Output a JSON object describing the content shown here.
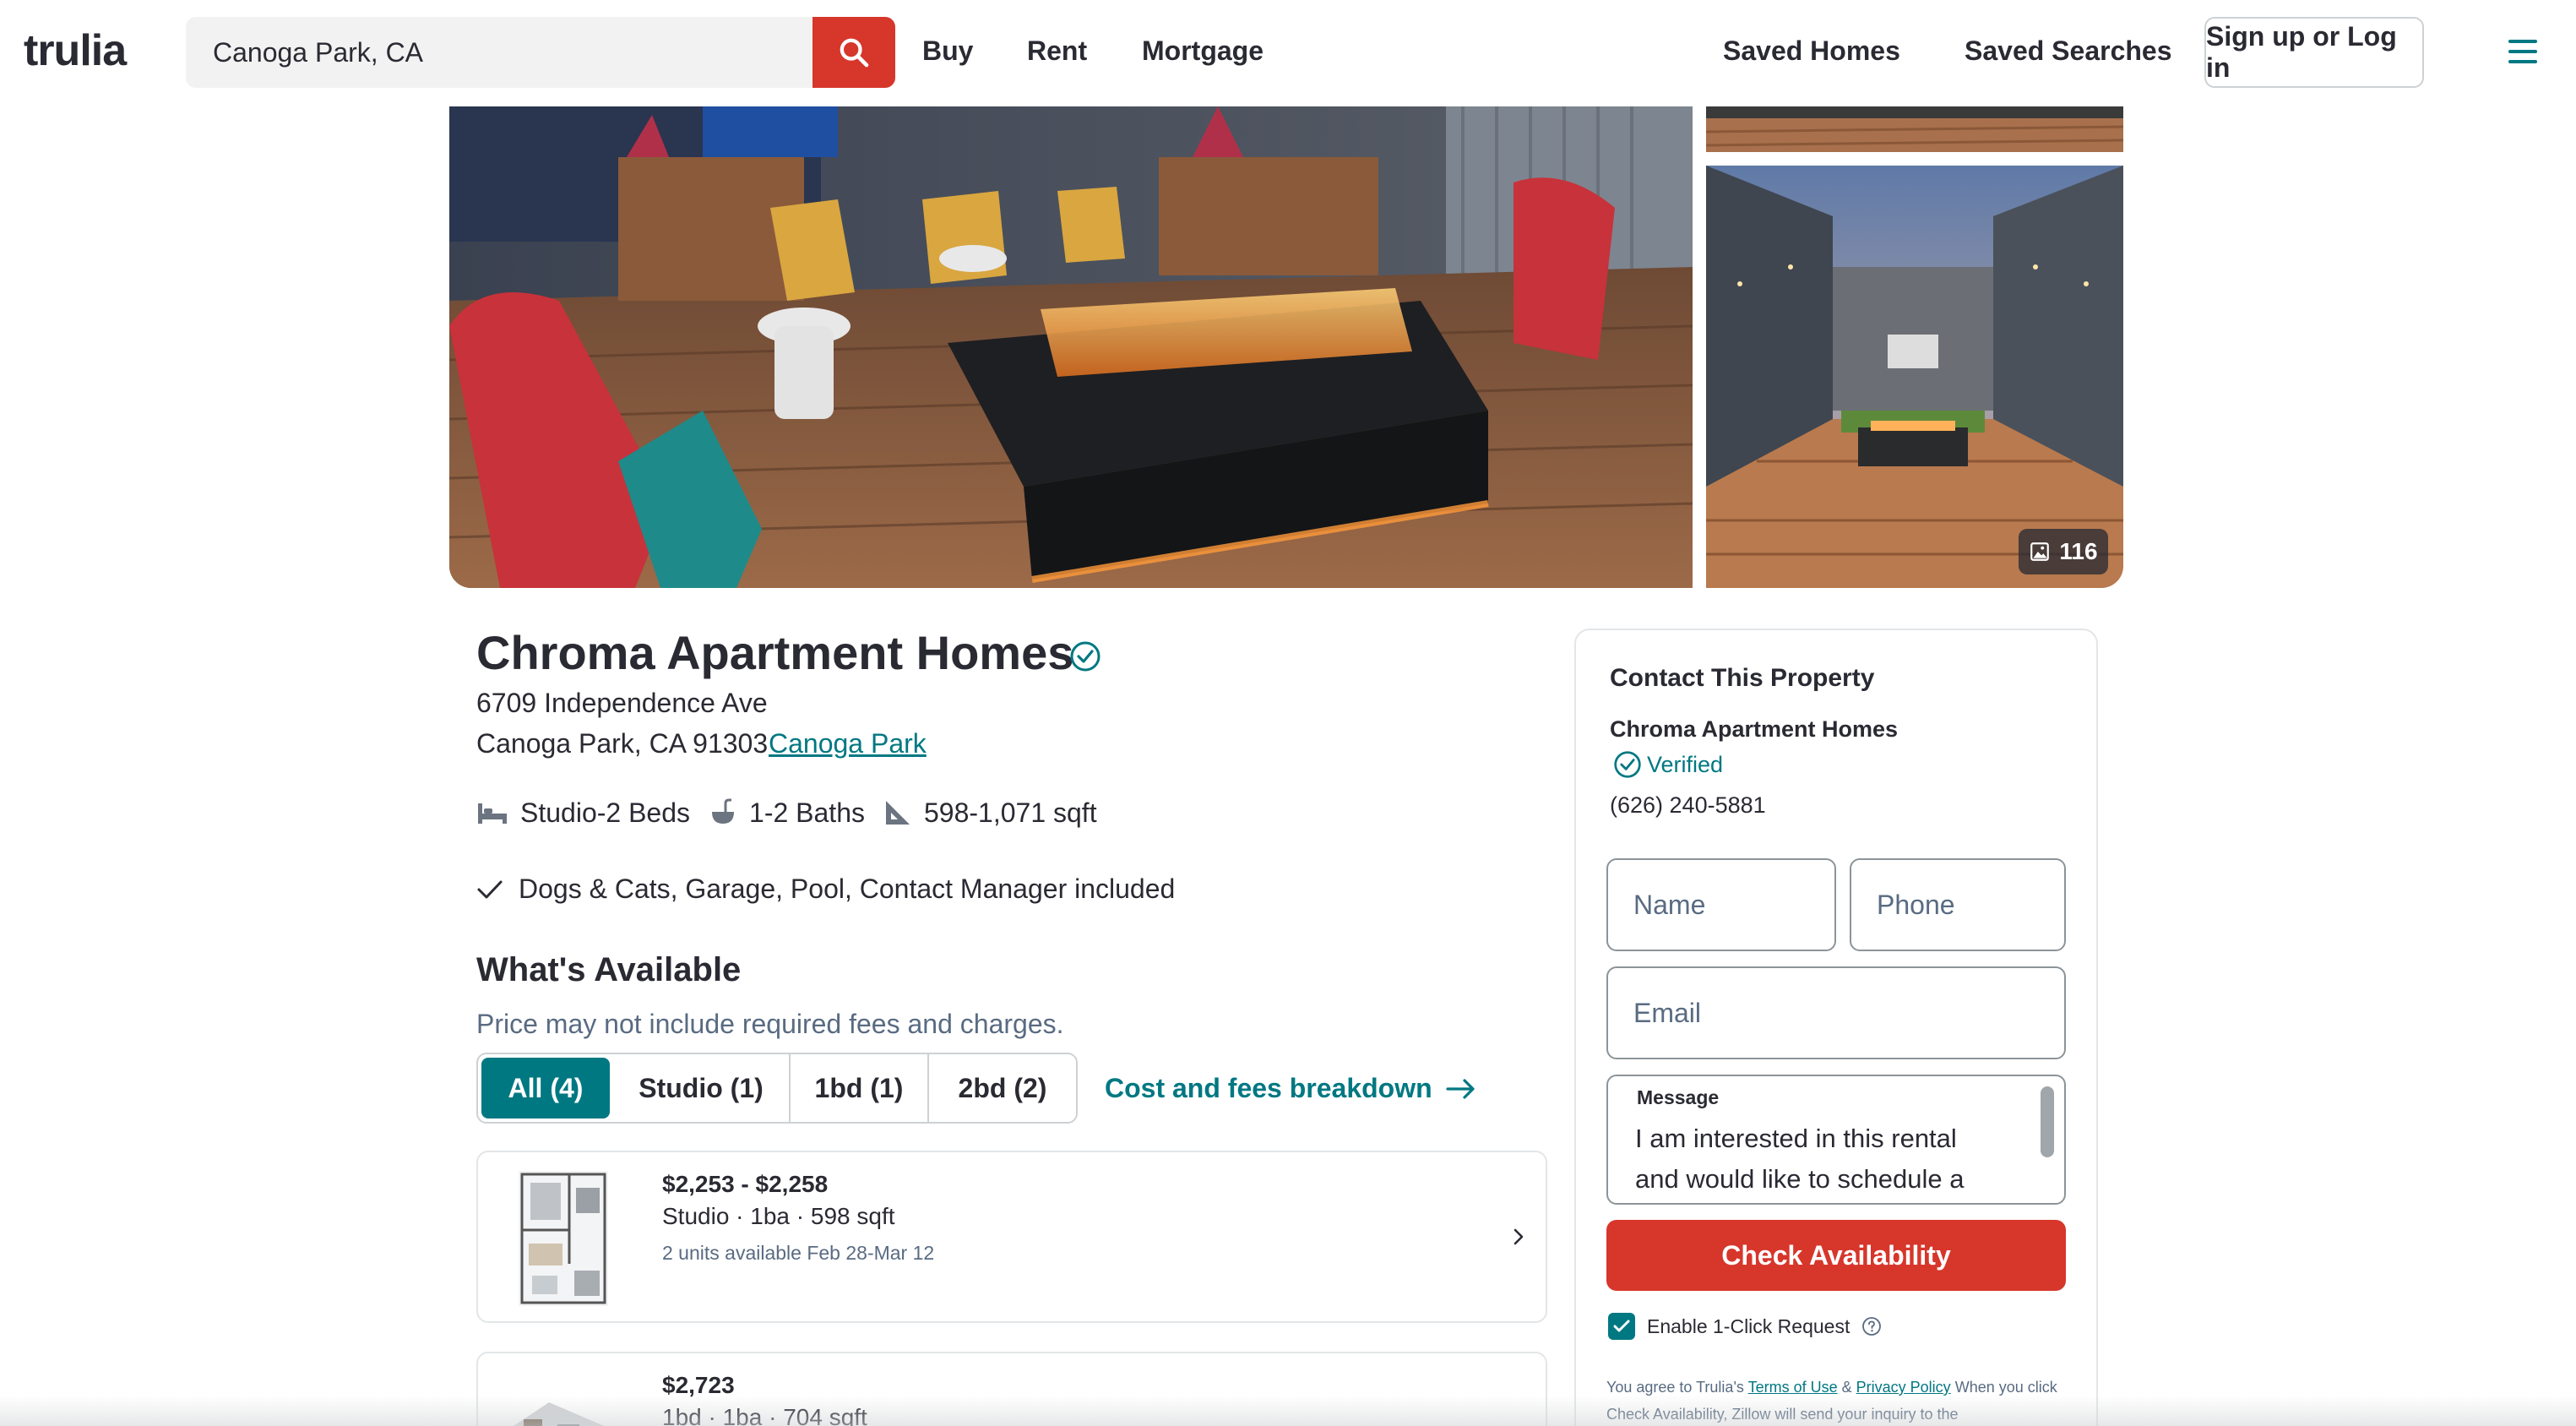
{
  "header": {
    "logo": "trulia",
    "search_value": "Canoga Park, CA",
    "nav": [
      "Buy",
      "Rent",
      "Mortgage"
    ],
    "saved_homes": "Saved Homes",
    "saved_searches": "Saved Searches",
    "login": "Sign up or Log in"
  },
  "gallery": {
    "photo_count": "116"
  },
  "property": {
    "name": "Chroma Apartment Homes",
    "address_line1": "6709 Independence Ave",
    "address_line2": "Canoga Park, CA 91303",
    "neighborhood": "Canoga Park",
    "beds": "Studio-2 Beds",
    "baths": "1-2 Baths",
    "sqft": "598-1,071 sqft",
    "amenities": "Dogs & Cats, Garage, Pool, Contact Manager included"
  },
  "availability": {
    "title": "What's Available",
    "price_note": "Price may not include required fees and charges.",
    "filters": [
      "All (4)",
      "Studio (1)",
      "1bd (1)",
      "2bd (2)"
    ],
    "active_filter": "All (4)",
    "fees_link": "Cost and fees breakdown",
    "units": [
      {
        "price": "$2,253 - $2,258",
        "details": "Studio · 1ba · 598 sqft",
        "availability": "2 units available Feb 28-Mar 12"
      },
      {
        "price": "$2,723",
        "details": "1bd · 1ba · 704 sqft",
        "availability": ""
      }
    ]
  },
  "contact": {
    "title": "Contact This Property",
    "property_name": "Chroma Apartment Homes",
    "verified": "Verified",
    "phone": "(626) 240-5881",
    "name_placeholder": "Name",
    "phone_placeholder": "Phone",
    "email_placeholder": "Email",
    "message_label": "Message",
    "message_text": "I am interested in this rental and would like to schedule a",
    "button": "Check Availability",
    "one_click": "Enable 1-Click Request",
    "legal_prefix": "You agree to Trulia's",
    "terms": "Terms of Use",
    "amp": "&",
    "privacy": "Privacy Policy",
    "legal_suffix": "When you click Check Availability, Zillow will send your inquiry to the"
  },
  "colors": {
    "brand_red": "#d7362b",
    "brand_teal": "#007882",
    "text": "#2a2a33"
  }
}
